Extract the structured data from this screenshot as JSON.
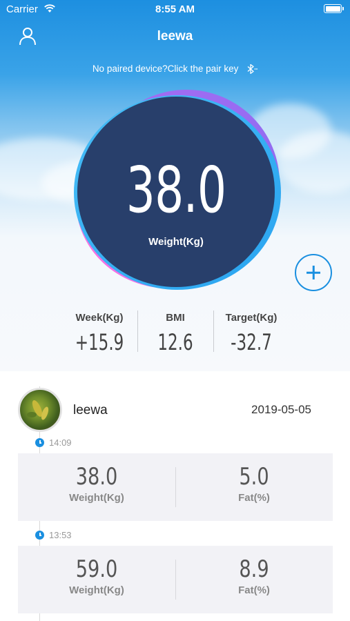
{
  "status_bar": {
    "carrier": "Carrier",
    "time": "8:55 AM"
  },
  "header": {
    "title": "leewa",
    "pair_prompt": "No paired device?Click the pair key"
  },
  "dial": {
    "weight": "38.0",
    "label": "Weight(Kg)"
  },
  "stats": [
    {
      "label": "Week(Kg)",
      "value": "+15.9"
    },
    {
      "label": "BMI",
      "value": "12.6"
    },
    {
      "label": "Target(Kg)",
      "value": "-32.7"
    }
  ],
  "history": {
    "user_name": "leewa",
    "date": "2019-05-05",
    "records": [
      {
        "time": "14:09",
        "weight": "38.0",
        "weight_label": "Weight(Kg)",
        "fat": "5.0",
        "fat_label": "Fat(%)"
      },
      {
        "time": "13:53",
        "weight": "59.0",
        "weight_label": "Weight(Kg)",
        "fat": "8.9",
        "fat_label": "Fat(%)"
      }
    ]
  },
  "colors": {
    "accent": "#1a8fe0",
    "dial": "#283f6b"
  },
  "icons": {
    "profile": "user-icon",
    "bluetooth": "bluetooth-icon",
    "add": "plus-circle-icon",
    "clock": "clock-icon"
  }
}
